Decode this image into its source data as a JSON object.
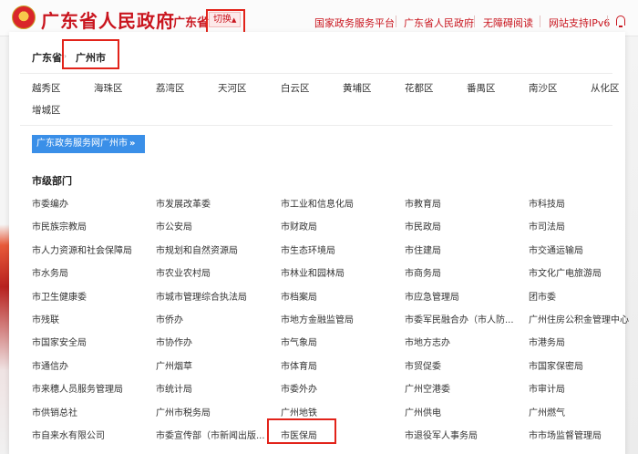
{
  "header": {
    "site_title": "广东省人民政府",
    "province_label": "广东省",
    "switch_label": "切换",
    "nav": [
      "国家政务服务平台",
      "广东省人民政府",
      "无障碍阅读",
      "网站支持IPv6"
    ],
    "accent_color": "#c9151e",
    "icons": [
      "national-emblem-icon",
      "caret-up-icon",
      "bell-icon"
    ]
  },
  "breadcrumb": {
    "province": "广东省",
    "city": "广州市"
  },
  "districts": [
    "越秀区",
    "海珠区",
    "荔湾区",
    "天河区",
    "白云区",
    "黄埔区",
    "花都区",
    "番禺区",
    "南沙区",
    "从化区",
    "增城区"
  ],
  "portal_button": {
    "label": "广东政务服务网广州市",
    "arrow": "»",
    "color": "#3a8fe8"
  },
  "departments": {
    "title": "市级部门",
    "rows": [
      [
        "市委编办",
        "市发展改革委",
        "市工业和信息化局",
        "市教育局",
        "市科技局"
      ],
      [
        "市民族宗教局",
        "市公安局",
        "市财政局",
        "市民政局",
        "市司法局"
      ],
      [
        "市人力资源和社会保障局",
        "市规划和自然资源局",
        "市生态环境局",
        "市住建局",
        "市交通运输局"
      ],
      [
        "市水务局",
        "市农业农村局",
        "市林业和园林局",
        "市商务局",
        "市文化广电旅游局"
      ],
      [
        "市卫生健康委",
        "市城市管理综合执法局",
        "市档案局",
        "市应急管理局",
        "团市委"
      ],
      [
        "市残联",
        "市侨办",
        "市地方金融监管局",
        "市委军民融合办（市人防...",
        "广州住房公积金管理中心"
      ],
      [
        "市国家安全局",
        "市协作办",
        "市气象局",
        "市地方志办",
        "市港务局"
      ],
      [
        "市通信办",
        "广州烟草",
        "市体育局",
        "市贸促委",
        "市国家保密局"
      ],
      [
        "市来穗人员服务管理局",
        "市统计局",
        "市委外办",
        "广州空港委",
        "市审计局"
      ],
      [
        "市供销总社",
        "广州市税务局",
        "广州地铁",
        "广州供电",
        "广州燃气"
      ],
      [
        "市自来水有限公司",
        "市委宣传部（市新闻出版...",
        "市医保局",
        "市退役军人事务局",
        "市市场监督管理局"
      ]
    ]
  }
}
